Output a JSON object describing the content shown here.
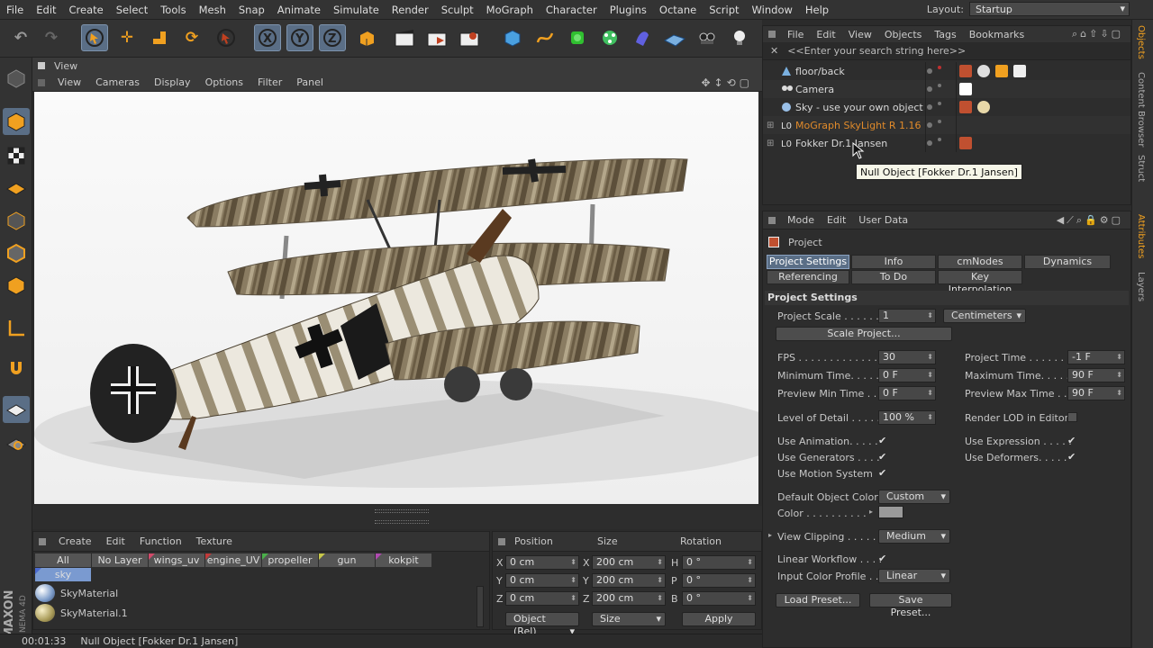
{
  "menubar": {
    "items": [
      "File",
      "Edit",
      "Create",
      "Select",
      "Tools",
      "Mesh",
      "Snap",
      "Animate",
      "Simulate",
      "Render",
      "Sculpt",
      "MoGraph",
      "Character",
      "Plugins",
      "Octane",
      "Script",
      "Window",
      "Help"
    ],
    "layout_label": "Layout:",
    "layout_value": "Startup"
  },
  "viewport": {
    "title": "View",
    "menu": [
      "View",
      "Cameras",
      "Display",
      "Options",
      "Filter",
      "Panel"
    ]
  },
  "materials": {
    "menu": [
      "Create",
      "Edit",
      "Function",
      "Texture"
    ],
    "layers": [
      {
        "name": "All",
        "color": ""
      },
      {
        "name": "No Layer",
        "color": ""
      },
      {
        "name": "wings_uv",
        "color": "#d24a6a"
      },
      {
        "name": "engine_UV",
        "color": "#c23a3a"
      },
      {
        "name": "propeller",
        "color": "#4ab04a"
      },
      {
        "name": "gun",
        "color": "#c8c84a"
      },
      {
        "name": "kokpit",
        "color": "#b04ab0"
      },
      {
        "name": "sky",
        "color": "#4a6ad0"
      }
    ],
    "items": [
      "SkyMaterial",
      "SkyMaterial.1"
    ]
  },
  "coords": {
    "headers": [
      "Position",
      "Size",
      "Rotation"
    ],
    "pos": [
      {
        "axis": "X",
        "val": "0 cm"
      },
      {
        "axis": "Y",
        "val": "0 cm"
      },
      {
        "axis": "Z",
        "val": "0 cm"
      }
    ],
    "size": [
      {
        "axis": "X",
        "val": "200 cm"
      },
      {
        "axis": "Y",
        "val": "200 cm"
      },
      {
        "axis": "Z",
        "val": "200 cm"
      }
    ],
    "rot": [
      {
        "axis": "H",
        "val": "0 °"
      },
      {
        "axis": "P",
        "val": "0 °"
      },
      {
        "axis": "B",
        "val": "0 °"
      }
    ],
    "mode": "Object (Rel)",
    "sizemode": "Size",
    "apply": "Apply"
  },
  "status": {
    "time": "00:01:33",
    "text": "Null Object [Fokker Dr.1 Jansen]"
  },
  "objects": {
    "menu": [
      "File",
      "Edit",
      "View",
      "Objects",
      "Tags",
      "Bookmarks"
    ],
    "search_placeholder": "<<Enter your search string here>>",
    "rows": [
      {
        "name": "floor/back",
        "color": "#d8d8d8"
      },
      {
        "name": "Camera",
        "color": "#d8d8d8"
      },
      {
        "name": "Sky - use your own object",
        "color": "#d8d8d8"
      },
      {
        "name": "MoGraph SkyLight R 1.16",
        "color": "#e08a2a"
      },
      {
        "name": "Fokker Dr.1 Jansen",
        "color": "#d8d8d8"
      }
    ],
    "tooltip": "Null Object [Fokker Dr.1 Jansen]"
  },
  "attributes": {
    "menu": [
      "Mode",
      "Edit",
      "User Data"
    ],
    "object_title": "Project",
    "tabs_row1": [
      "Project Settings",
      "Info",
      "cmNodes",
      "Dynamics"
    ],
    "tabs_row2": [
      "Referencing",
      "To Do",
      "Key Interpolation"
    ],
    "section": "Project Settings",
    "project_scale_label": "Project Scale . . . . . .",
    "project_scale_value": "1",
    "project_scale_unit": "Centimeters",
    "scale_button": "Scale Project...",
    "fps_label": "FPS . . . . . . . . . . . . . .",
    "fps": "30",
    "project_time_label": "Project Time . . . . . .",
    "project_time": "-1 F",
    "min_time_label": "Minimum Time. . . . . .",
    "min_time": "0 F",
    "max_time_label": "Maximum Time. . . . . .",
    "max_time": "90 F",
    "prev_min_label": "Preview Min Time . . .",
    "prev_min": "0 F",
    "prev_max_label": "Preview Max Time . . .",
    "prev_max": "90 F",
    "lod_label": "Level of Detail . . . . .",
    "lod": "100 %",
    "render_lod_label": "Render LOD in Editor",
    "use_animation": "Use Animation. . . . .",
    "use_expression": "Use Expression . . . . .",
    "use_generators": "Use Generators . . . .",
    "use_deformers": "Use Deformers. . . . .",
    "use_motion": "Use Motion System",
    "default_color_label": "Default Object Color",
    "default_color": "Custom",
    "color_label": "Color . . . . . . . . . .",
    "view_clipping_label": "View Clipping . . . . . .",
    "view_clipping": "Medium",
    "linear_label": "Linear Workflow . . . .",
    "input_color_label": "Input Color Profile . .",
    "input_color": "Linear",
    "load_preset": "Load Preset...",
    "save_preset": "Save Preset..."
  },
  "sidebar_tabs": [
    "Objects",
    "Content Browser",
    "Struct",
    "Attributes",
    "Layers"
  ]
}
